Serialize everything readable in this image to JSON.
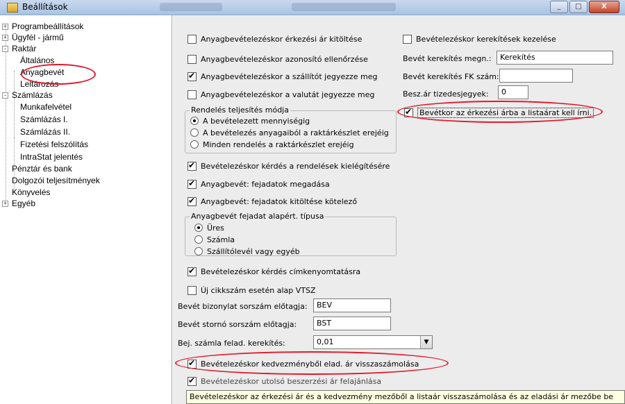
{
  "window": {
    "title": "Beállítások",
    "controls": {
      "minimize": "_",
      "maximize": "□",
      "close": "X"
    }
  },
  "tree": {
    "items": [
      {
        "label": "Programbeállítások",
        "expander": "+"
      },
      {
        "label": "Ügyfél - jármű",
        "expander": "+"
      },
      {
        "label": "Raktár",
        "expander": "-"
      },
      {
        "label": "Általános"
      },
      {
        "label": "Anyagbevét"
      },
      {
        "label": "Leltározás"
      },
      {
        "label": "Számlázás",
        "expander": "-"
      },
      {
        "label": "Munkafelvétel"
      },
      {
        "label": "Számlázás I."
      },
      {
        "label": "Számlázás II."
      },
      {
        "label": "Fizetési felszólítás"
      },
      {
        "label": "IntraStat jelentés"
      },
      {
        "label": "Pénztár és bank"
      },
      {
        "label": "Dolgozói teljesítmények"
      },
      {
        "label": "Könyvelés"
      },
      {
        "label": "Egyéb",
        "expander": "+"
      }
    ]
  },
  "settings": {
    "left_checks": [
      {
        "label": "Anyagbevételezéskor érkezési ár kitöltése",
        "checked": false
      },
      {
        "label": "Anyagbevételezéskor azonosító ellenőrzése",
        "checked": false
      },
      {
        "label": "Anyagbevételezéskor a szállítót jegyezze meg",
        "checked": true
      },
      {
        "label": "Anyagbevételezéskor a valutát jegyezze meg",
        "checked": false
      }
    ],
    "rounding": {
      "check_label": "Bevételezéskor kerekítések kezelése",
      "name_label": "Bevét kerekítés megn.:",
      "name_value": "Kerekítés",
      "fk_label": "Bevét kerekítés FK szám:",
      "fk_value": "",
      "decimals_label": "Besz.ár tizedesjegyek:",
      "decimals_value": "0",
      "listprice_label": "Bevétkor az érkezési árba a listaárat kell írni."
    },
    "order_group": {
      "title": "Rendelés teljesítés módja",
      "options": [
        "A bevételezett mennyiségig",
        "A bevételezés anyagaiból a raktárkészlet erejéig",
        "Minden rendelés a raktárkészlet erejéig"
      ]
    },
    "mid_checks": [
      "Bevételezéskor kérdés a rendelések kielégítésére",
      "Anyagbevét: fejadatok megadása",
      "Anyagbevét: fejadatok kitöltése kötelező"
    ],
    "header_group": {
      "title": "Anyagbevét fejadat alapért. típusa",
      "options": [
        "Üres",
        "Számla",
        "Szállítólevél vagy egyéb"
      ]
    },
    "label_print_check": "Bevételezéskor kérdés címkenyomtatásra",
    "vtsz_check": "Új cikkszám esetén alap VTSZ",
    "prefix_label": "Bevét bizonylat sorszám előtagja:",
    "prefix_value": "BEV",
    "storno_label": "Bevét stornó sorszám előtagja:",
    "storno_value": "BST",
    "invoice_round_label": "Bej. számla felad. kerekítés:",
    "invoice_round_value": "0,01",
    "discount_check": "Bevételezéskor kedvezményből elad. ár visszaszámolása",
    "partial_check": "Bevételezéskor utolsó beszerzési ár felajánlása"
  },
  "tooltip": "Bevételezéskor az érkezési ár és a kedvezmény mezőből a listaár visszaszámolása és az eladási ár mezőbe be",
  "colors": {
    "annotation": "#e0182d",
    "tooltip_bg": "#ffffe1"
  }
}
